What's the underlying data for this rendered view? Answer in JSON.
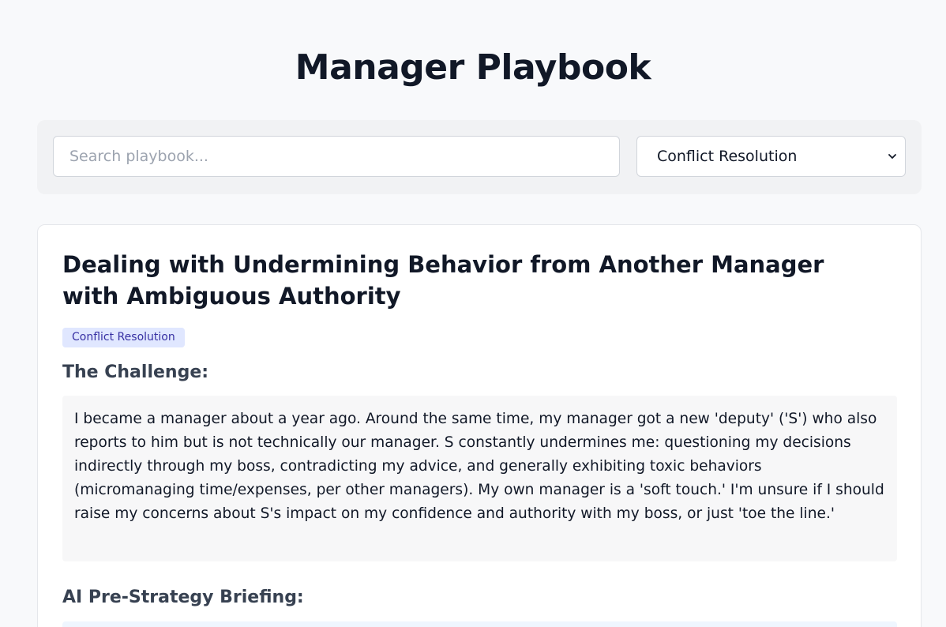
{
  "page": {
    "title": "Manager Playbook"
  },
  "filters": {
    "search_placeholder": "Search playbook...",
    "search_value": "",
    "category_selected": "Conflict Resolution",
    "chevron_icon": "chevron-down-icon"
  },
  "entry": {
    "title": "Dealing with Undermining Behavior from Another Manager with Ambiguous Authority",
    "tag": "Conflict Resolution",
    "challenge_heading": "The Challenge:",
    "challenge_text": "I became a manager about a year ago. Around the same time, my manager got a new 'deputy' ('S') who also reports to him but is not technically our manager. S constantly undermines me: questioning my decisions indirectly through my boss, contradicting my advice, and generally exhibiting toxic behaviors (micromanaging time/expenses, per other managers). My own manager is a 'soft touch.' I'm unsure if I should raise my concerns about S's impact on my confidence and authority with my boss, or just 'toe the line.'",
    "briefing_heading": "AI Pre-Strategy Briefing:"
  },
  "colors": {
    "background": "#f8f9fb",
    "tag_bg": "#e0e7ff",
    "tag_text": "#3730a3",
    "challenge_bg": "#f7f7f8",
    "briefing_bg": "#eff6ff"
  }
}
